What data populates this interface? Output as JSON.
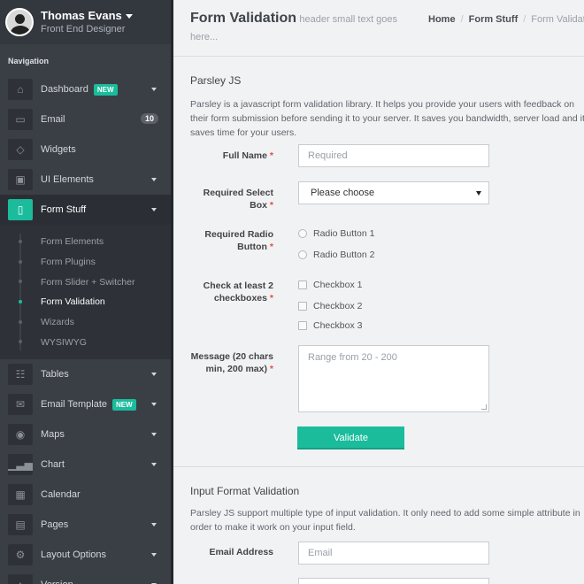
{
  "profile": {
    "name": "Thomas Evans",
    "role": "Front End Designer"
  },
  "nav": {
    "heading": "Navigation",
    "items_top": [
      {
        "label": "Dashboard",
        "icon": "home-icon",
        "badge": "NEW",
        "chevron": true
      },
      {
        "label": "Email",
        "icon": "inbox-icon",
        "count": "10"
      },
      {
        "label": "Widgets",
        "icon": "diamond-icon"
      },
      {
        "label": "UI Elements",
        "icon": "briefcase-icon",
        "chevron": true
      },
      {
        "label": "Form Stuff",
        "icon": "file-icon",
        "chevron": true,
        "active": true
      }
    ],
    "sub_items": [
      {
        "label": "Form Elements"
      },
      {
        "label": "Form Plugins"
      },
      {
        "label": "Form Slider + Switcher"
      },
      {
        "label": "Form Validation",
        "active": true
      },
      {
        "label": "Wizards"
      },
      {
        "label": "WYSIWYG"
      }
    ],
    "items_bottom": [
      {
        "label": "Tables",
        "icon": "grid-icon",
        "chevron": true
      },
      {
        "label": "Email Template",
        "icon": "envelope-icon",
        "badge": "NEW",
        "chevron": true
      },
      {
        "label": "Maps",
        "icon": "map-pin-icon",
        "chevron": true
      },
      {
        "label": "Chart",
        "icon": "bar-chart-icon",
        "chevron": true
      },
      {
        "label": "Calendar",
        "icon": "calendar-icon"
      },
      {
        "label": "Pages",
        "icon": "pages-icon",
        "chevron": true
      },
      {
        "label": "Layout Options",
        "icon": "gear-icon",
        "chevron": true
      },
      {
        "label": "Version",
        "icon": "tag-icon",
        "chevron": true
      }
    ]
  },
  "header": {
    "title": "Form Validation",
    "subtitle_part1": "header small text goes",
    "subtitle_part2": "here...",
    "breadcrumb": [
      "Home",
      "Form Stuff",
      "Form Validation"
    ]
  },
  "parsley": {
    "title": "Parsley JS",
    "desc_line1": "Parsley is a javascript form validation library. It helps you provide your users with feedback on",
    "desc_line2": "their form submission before sending it to your server. It saves you bandwidth, server load and it",
    "desc_line3": "saves time for your users.",
    "full_name_label": "Full Name",
    "full_name_placeholder": "Required",
    "select_label_1": "Required Select",
    "select_label_2": "Box",
    "select_value": "Please choose",
    "radio_label_1": "Required Radio",
    "radio_label_2": "Button",
    "radios": [
      "Radio Button 1",
      "Radio Button 2"
    ],
    "check_label_1": "Check at least 2",
    "check_label_2": "checkboxes",
    "checkboxes": [
      "Checkbox 1",
      "Checkbox 2",
      "Checkbox 3"
    ],
    "message_label_1": "Message (20 chars",
    "message_label_2": "min, 200 max)",
    "message_placeholder": "Range from 20 - 200",
    "validate_button": "Validate",
    "required_mark": "*"
  },
  "input_format": {
    "title": "Input Format Validation",
    "desc_line1": "Parsley JS support multiple type of input validation. It only need to add some simple attribute in",
    "desc_line2": "order to make it work on your input field.",
    "email_label": "Email Address",
    "email_placeholder": "Email"
  },
  "colors": {
    "accent": "#1abc9c",
    "sidebar": "#3a3f46",
    "required": "#e74c3c"
  }
}
